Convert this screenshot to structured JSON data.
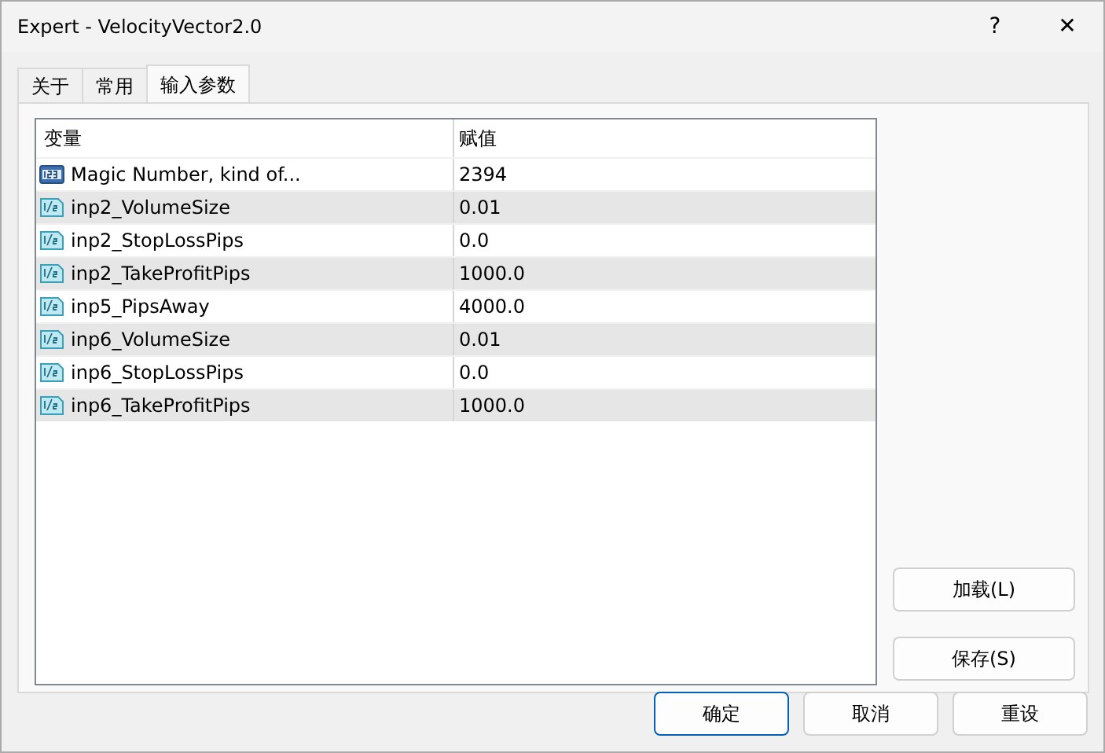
{
  "window": {
    "title": "Expert - VelocityVector2.0",
    "help": "?",
    "close": "✕"
  },
  "tabs": [
    {
      "label": "关于",
      "selected": false
    },
    {
      "label": "常用",
      "selected": false
    },
    {
      "label": "输入参数",
      "selected": true
    }
  ],
  "table": {
    "columns": [
      "变量",
      "赋值"
    ],
    "rows": [
      {
        "kind": "int",
        "name": "Magic Number, kind of...",
        "value": "2394"
      },
      {
        "kind": "double",
        "name": "inp2_VolumeSize",
        "value": "0.01"
      },
      {
        "kind": "double",
        "name": "inp2_StopLossPips",
        "value": "0.0"
      },
      {
        "kind": "double",
        "name": "inp2_TakeProfitPips",
        "value": "1000.0"
      },
      {
        "kind": "double",
        "name": "inp5_PipsAway",
        "value": "4000.0"
      },
      {
        "kind": "double",
        "name": "inp6_VolumeSize",
        "value": "0.01"
      },
      {
        "kind": "double",
        "name": "inp6_StopLossPips",
        "value": "0.0"
      },
      {
        "kind": "double",
        "name": "inp6_TakeProfitPips",
        "value": "1000.0"
      }
    ]
  },
  "side_buttons": [
    "加载(L)",
    "保存(S)"
  ],
  "buttons": [
    {
      "label": "确定",
      "default": true
    },
    {
      "label": "取消",
      "default": false
    },
    {
      "label": "重设",
      "default": false
    }
  ]
}
